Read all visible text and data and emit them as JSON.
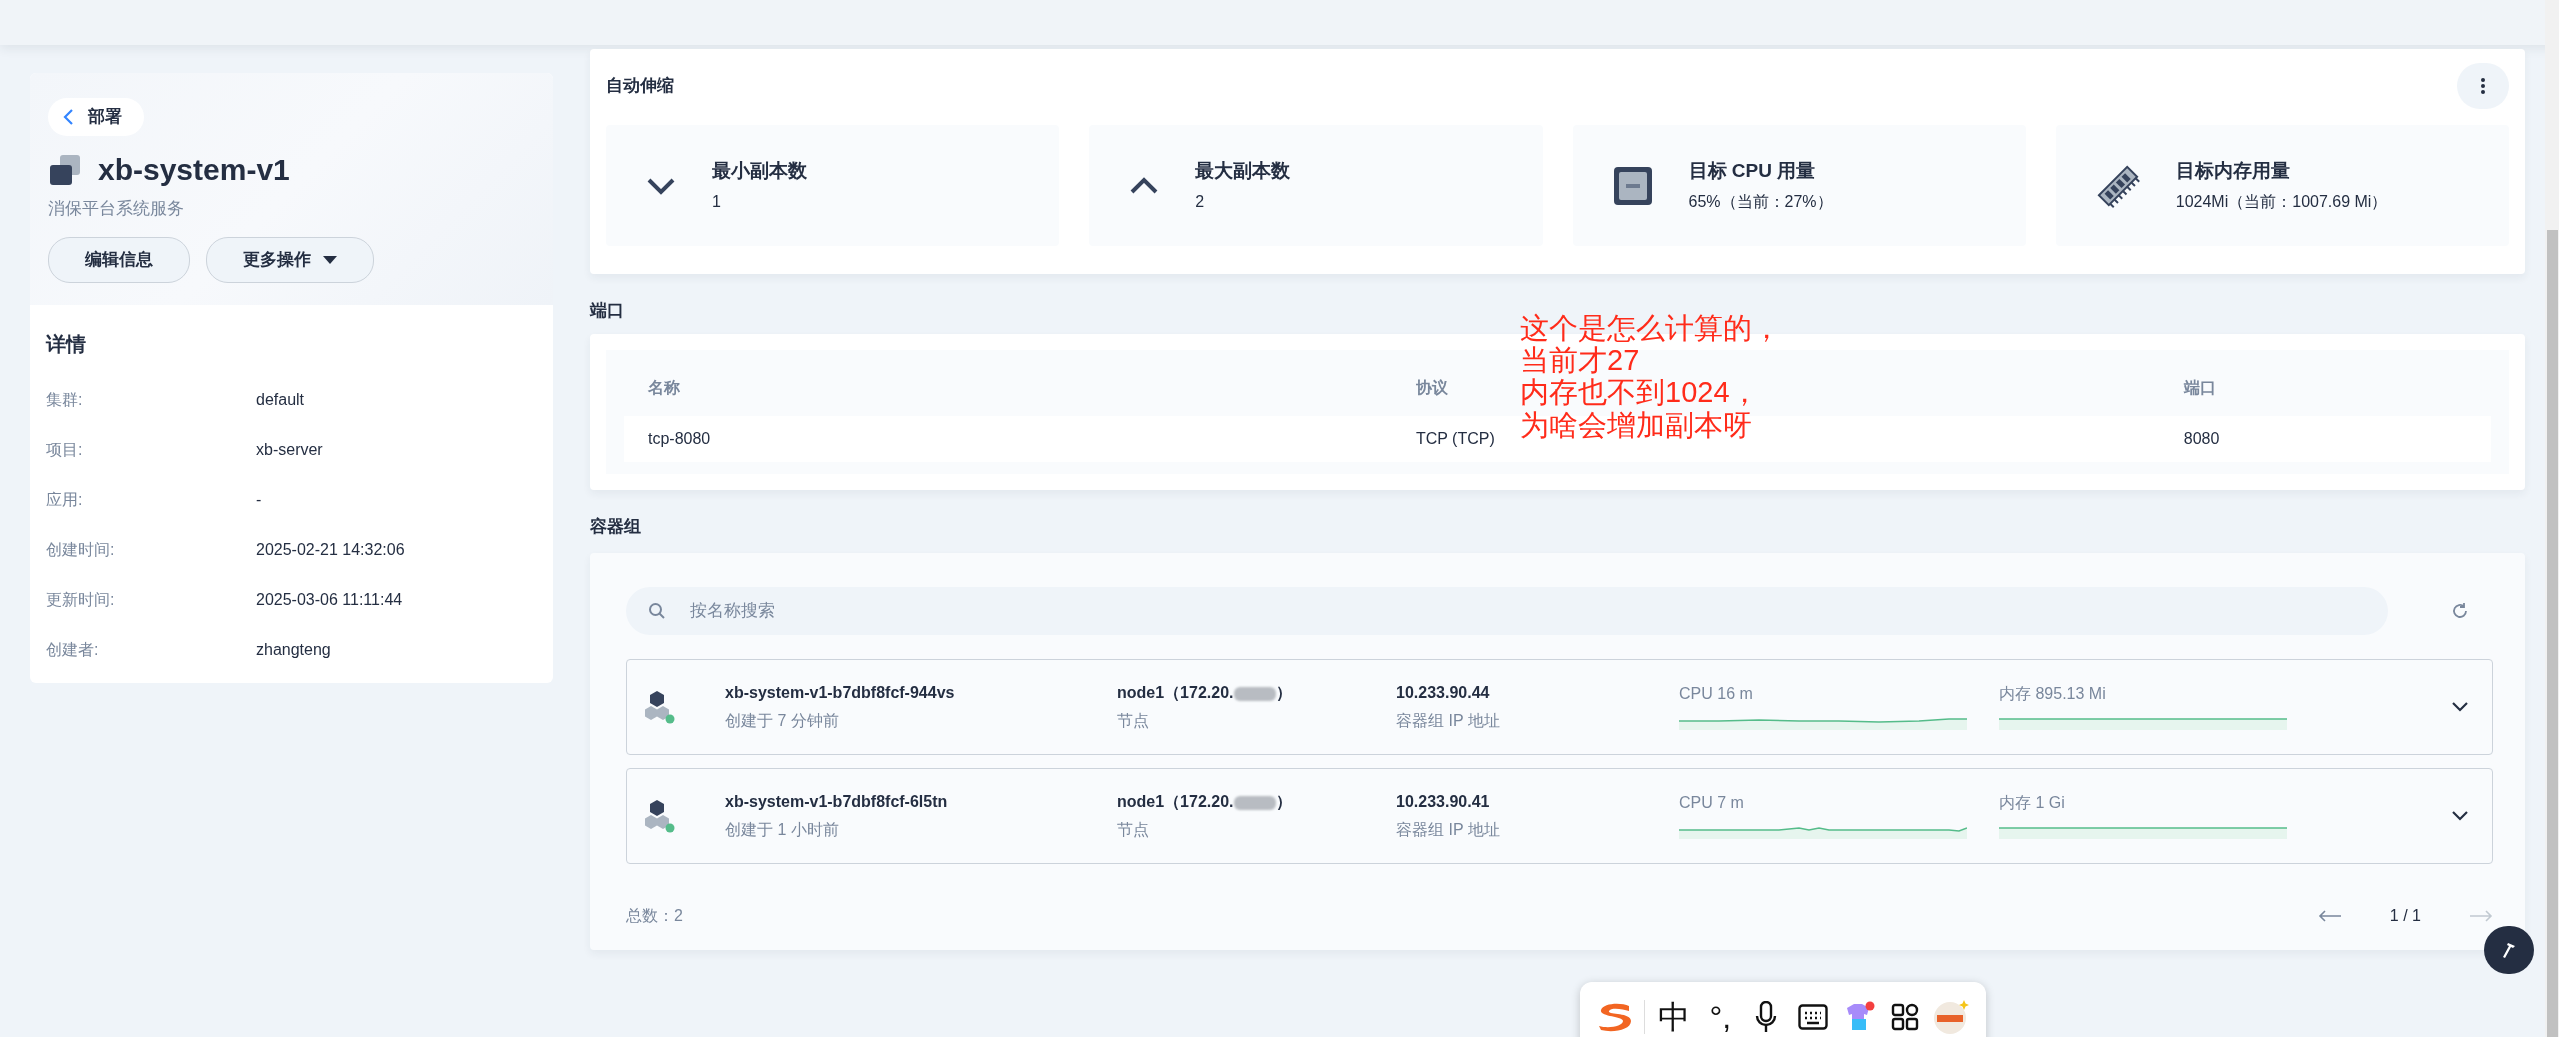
{
  "sidebar": {
    "back_button": "部署",
    "title": "xb-system-v1",
    "description": "消保平台系统服务",
    "buttons": [
      {
        "label": "编辑信息",
        "kind": "plain"
      },
      {
        "label": "更多操作",
        "kind": "dropdown"
      }
    ],
    "details_title": "详情",
    "details": [
      {
        "label": "集群:",
        "value": "default"
      },
      {
        "label": "项目:",
        "value": "xb-server"
      },
      {
        "label": "应用:",
        "value": "-"
      },
      {
        "label": "创建时间:",
        "value": "2025-02-21 14:32:06"
      },
      {
        "label": "更新时间:",
        "value": "2025-03-06 11:11:44"
      },
      {
        "label": "创建者:",
        "value": "zhangteng"
      }
    ]
  },
  "autoscaling": {
    "title": "自动伸缩",
    "metrics": [
      {
        "kind": "min",
        "title": "最小副本数",
        "value": "1"
      },
      {
        "kind": "max",
        "title": "最大副本数",
        "value": "2"
      },
      {
        "kind": "cpu",
        "title": "目标 CPU 用量",
        "value": "65%（当前：27%）"
      },
      {
        "kind": "memory",
        "title": "目标内存用量",
        "value": "1024Mi（当前：1007.69 Mi）"
      }
    ]
  },
  "ports": {
    "title": "端口",
    "columns": [
      "名称",
      "协议",
      "端口"
    ],
    "rows": [
      [
        "tcp-8080",
        "TCP (TCP)",
        "8080"
      ]
    ]
  },
  "annotation": {
    "lines": [
      "这个是怎么计算的，",
      "当前才27",
      "内存也不到1024，",
      "为啥会增加副本呀"
    ]
  },
  "pods": {
    "title": "容器组",
    "search_placeholder": "按名称搜索",
    "items": [
      {
        "name": "xb-system-v1-b7dbf8fcf-944vs",
        "created": "创建于 7 分钟前",
        "node_prefix": "node1（172.20.",
        "node_suffix": "）",
        "node_label": "节点",
        "ip": "10.233.90.44",
        "ip_label": "容器组 IP 地址",
        "cpu": "CPU 16 m",
        "memory": "内存 895.13 Mi"
      },
      {
        "name": "xb-system-v1-b7dbf8fcf-6l5tn",
        "created": "创建于 1 小时前",
        "node_prefix": "node1（172.20.",
        "node_suffix": "）",
        "node_label": "节点",
        "ip": "10.233.90.41",
        "ip_label": "容器组 IP 地址",
        "cpu": "CPU 7 m",
        "memory": "内存 1 Gi"
      }
    ],
    "total": "总数：2",
    "page": "1 / 1"
  },
  "ime_toolbar": {
    "items": [
      {
        "kind": "logo"
      },
      {
        "kind": "text",
        "text": "中"
      },
      {
        "kind": "text",
        "text": "°,"
      },
      {
        "kind": "mic"
      },
      {
        "kind": "keyboard"
      },
      {
        "kind": "skin"
      },
      {
        "kind": "apps"
      },
      {
        "kind": "avatar"
      }
    ]
  }
}
